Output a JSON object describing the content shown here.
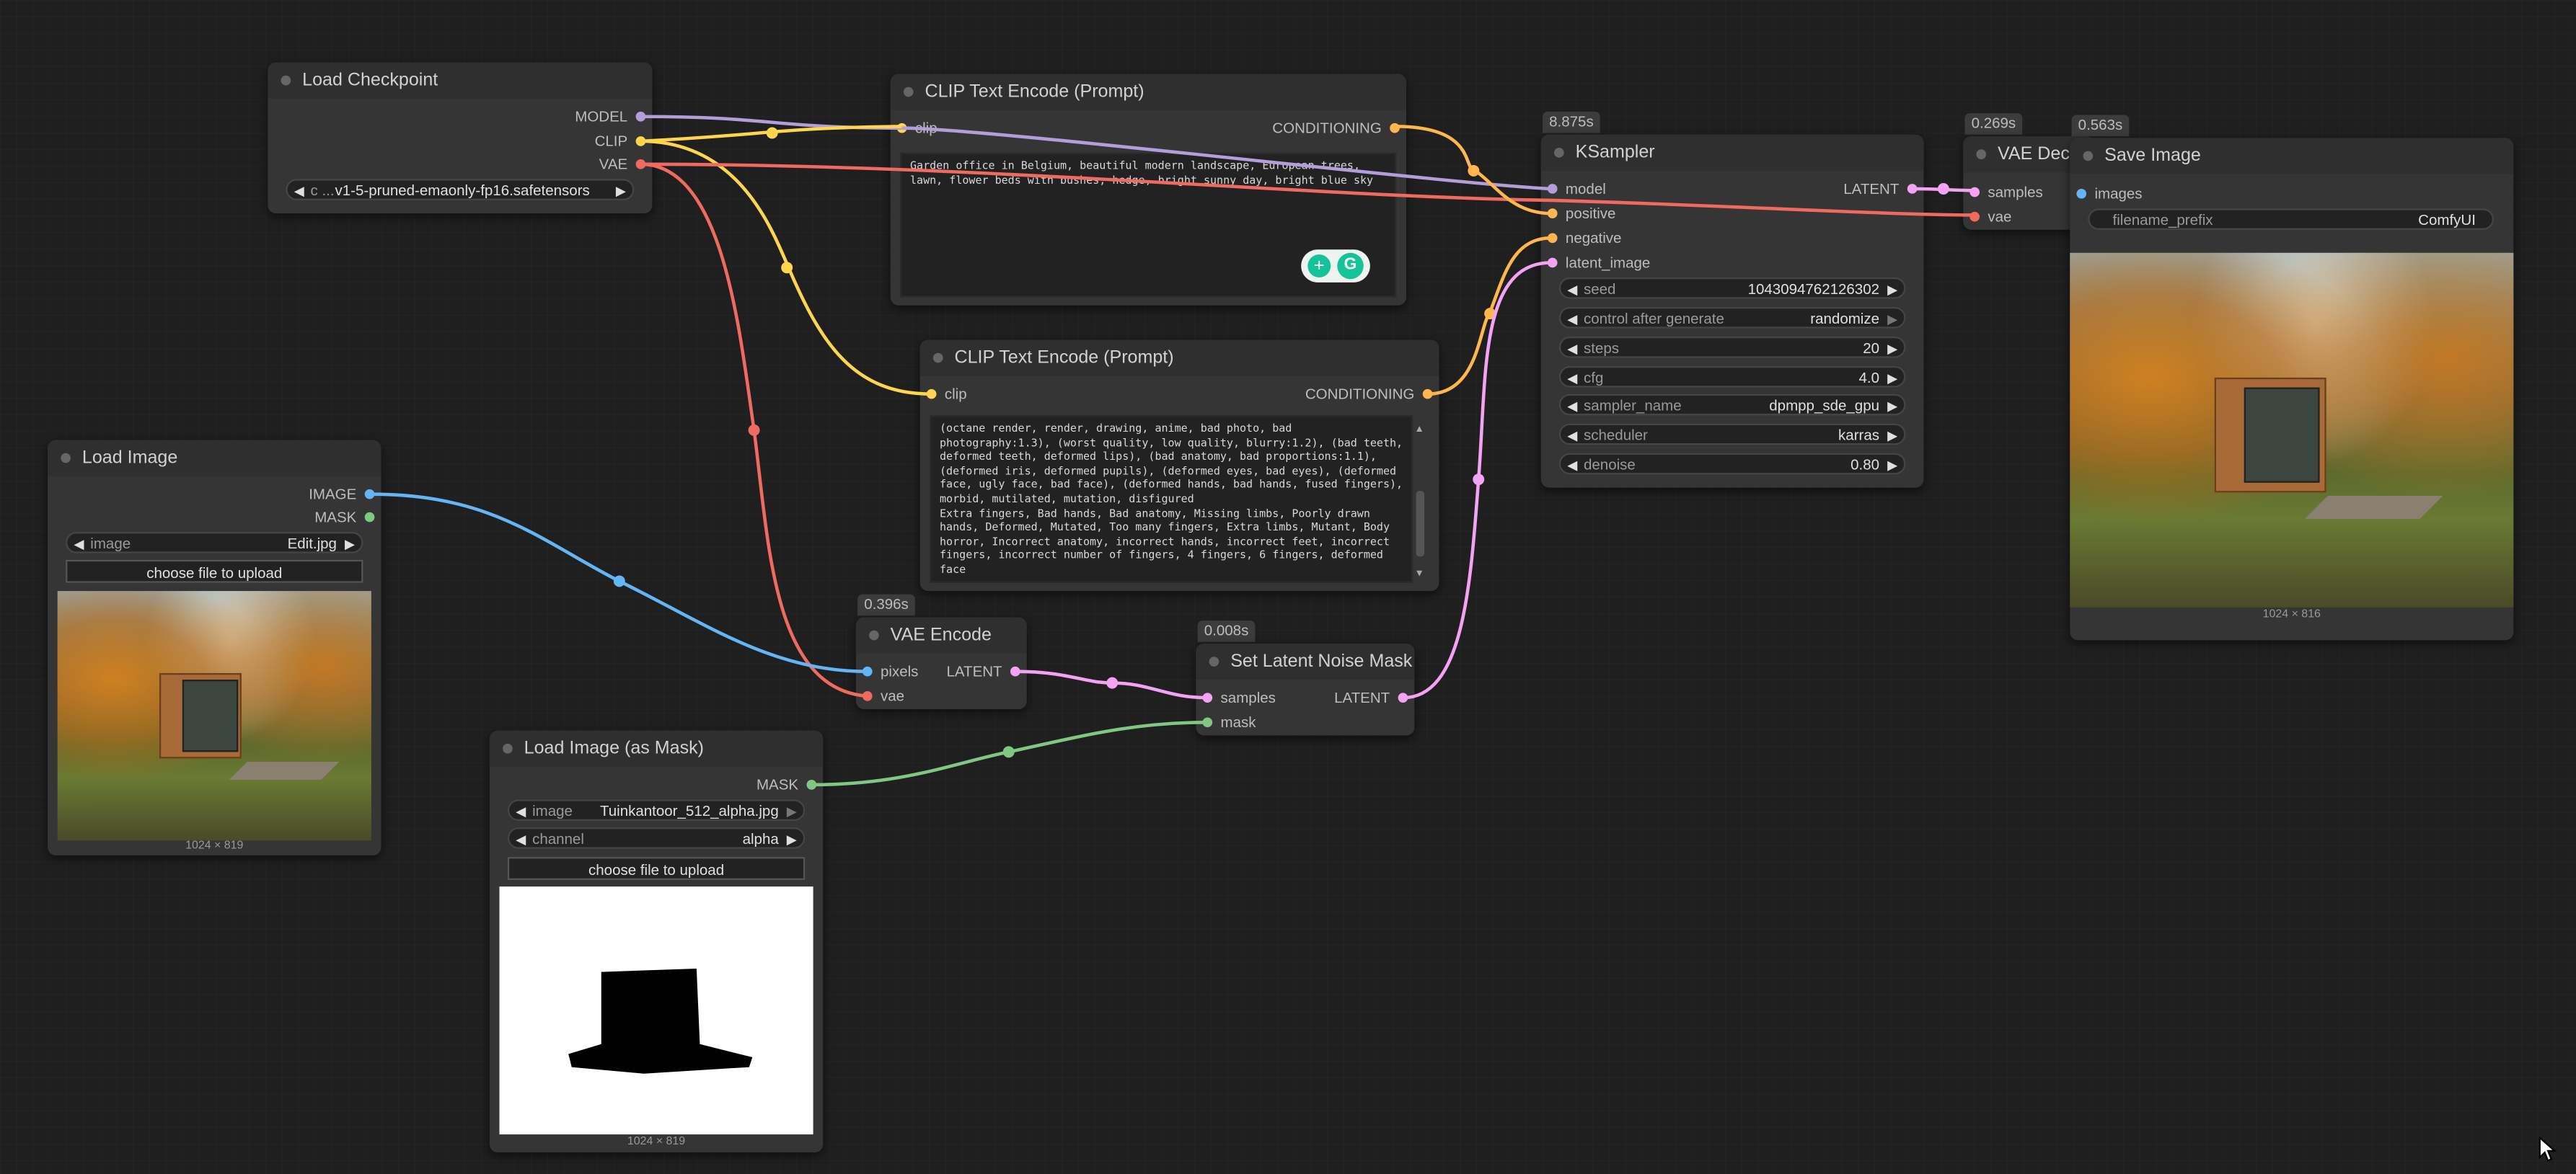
{
  "colors": {
    "model": "#b39ddb",
    "clip": "#ffd54f",
    "vae": "#ef6b5f",
    "conditioning": "#ffb74d",
    "latent": "#f4a2f4",
    "image": "#64b5f6",
    "mask": "#81c784"
  },
  "nodes": {
    "load_checkpoint": {
      "title": "Load Checkpoint",
      "outputs": [
        "MODEL",
        "CLIP",
        "VAE"
      ],
      "ckpt_label": "c ...",
      "ckpt_name": "v1-5-pruned-emaonly-fp16.safetensors"
    },
    "clip_pos": {
      "title": "CLIP Text Encode (Prompt)",
      "input": "clip",
      "output": "CONDITIONING",
      "text": "Garden office in Belgium, beautiful modern landscape, European trees, lawn, flower beds with bushes, hedge, bright sunny day, bright blue sky"
    },
    "clip_neg": {
      "title": "CLIP Text Encode (Prompt)",
      "input": "clip",
      "output": "CONDITIONING",
      "text": "(octane render, render, drawing, anime, bad photo, bad photography:1.3), (worst quality, low quality, blurry:1.2), (bad teeth, deformed teeth, deformed lips), (bad anatomy, bad proportions:1.1), (deformed iris, deformed pupils), (deformed eyes, bad eyes), (deformed face, ugly face, bad face), (deformed hands, bad hands, fused fingers), morbid, mutilated, mutation, disfigured\nExtra fingers, Bad hands, Bad anatomy, Missing limbs, Poorly drawn hands, Deformed, Mutated, Too many fingers, Extra limbs, Mutant, Body horror, Incorrect anatomy, incorrect hands, incorrect feet, incorrect fingers, incorrect number of fingers, 4 fingers, 6 fingers, deformed face"
    },
    "ksampler": {
      "title": "KSampler",
      "timing": "8.875s",
      "inputs": [
        "model",
        "positive",
        "negative",
        "latent_image"
      ],
      "output": "LATENT",
      "widgets": [
        {
          "label": "seed",
          "value": "1043094762126302"
        },
        {
          "label": "control after generate",
          "value": "randomize"
        },
        {
          "label": "steps",
          "value": "20"
        },
        {
          "label": "cfg",
          "value": "4.0"
        },
        {
          "label": "sampler_name",
          "value": "dpmpp_sde_gpu"
        },
        {
          "label": "scheduler",
          "value": "karras"
        },
        {
          "label": "denoise",
          "value": "0.80"
        }
      ]
    },
    "vae_decode": {
      "title": "VAE Deco",
      "timing": "0.269s",
      "inputs": [
        "samples",
        "vae"
      ]
    },
    "save_image": {
      "title": "Save Image",
      "timing": "0.563s",
      "input": "images",
      "prefix_label": "filename_prefix",
      "prefix_value": "ComfyUI",
      "caption": "1024 × 816"
    },
    "load_image": {
      "title": "Load Image",
      "outputs": [
        "IMAGE",
        "MASK"
      ],
      "image_label": "image",
      "image_value": "Edit.jpg",
      "upload_label": "choose file to upload",
      "caption": "1024 × 819"
    },
    "vae_encode": {
      "title": "VAE Encode",
      "timing": "0.396s",
      "inputs": [
        "pixels",
        "vae"
      ],
      "output": "LATENT"
    },
    "set_latent_mask": {
      "title": "Set Latent Noise Mask",
      "timing": "0.008s",
      "inputs": [
        "samples",
        "mask"
      ],
      "output": "LATENT"
    },
    "load_mask": {
      "title": "Load Image (as Mask)",
      "output": "MASK",
      "image_label": "image",
      "image_value": "Tuinkantoor_512_alpha.jpg",
      "channel_label": "channel",
      "channel_value": "alpha",
      "upload_label": "choose file to upload",
      "caption": "1024 × 819"
    }
  }
}
